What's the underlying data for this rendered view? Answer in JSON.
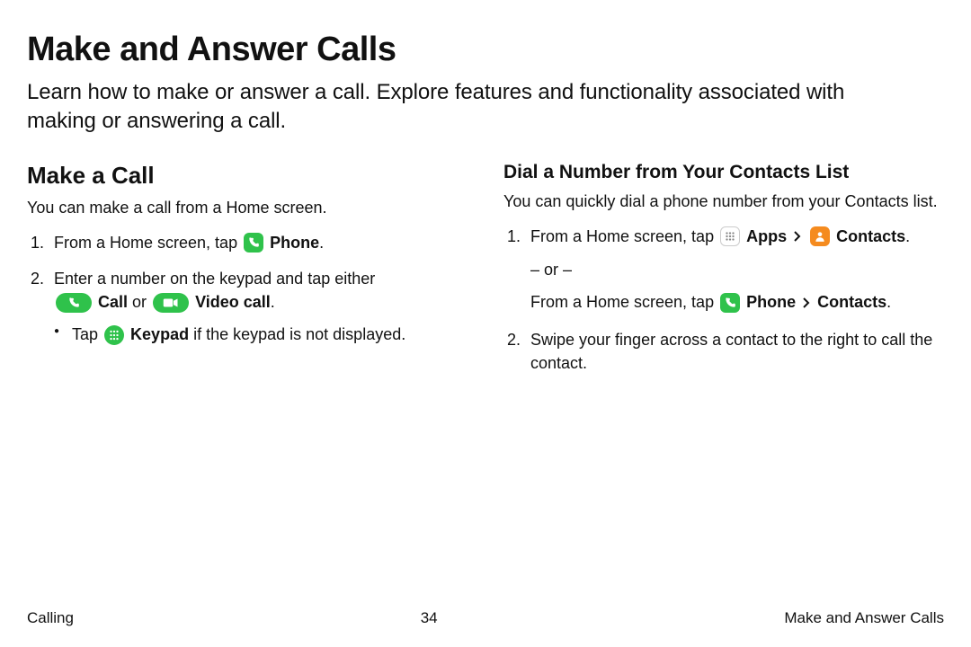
{
  "page": {
    "title": "Make and Answer Calls",
    "intro": "Learn how to make or answer a call. Explore features and functionality associated with making or answering a call."
  },
  "left": {
    "heading": "Make a Call",
    "intro": "You can make a call from a Home screen.",
    "step1": {
      "num": "1.",
      "pre": "From a Home screen, tap ",
      "phone_label": "Phone",
      "post": "."
    },
    "step2": {
      "num": "2.",
      "line": "Enter a number on the keypad and tap either",
      "call_label": "Call",
      "or": " or ",
      "video_label": "Video call",
      "period": ".",
      "bullet_pre": "Tap ",
      "bullet_bold": "Keypad",
      "bullet_post": " if the keypad is not displayed."
    }
  },
  "right": {
    "heading": "Dial a Number from Your Contacts List",
    "intro": "You can quickly dial a phone number from your Contacts list.",
    "step1": {
      "num": "1.",
      "pre": "From a Home screen, tap ",
      "apps_label": "Apps",
      "contacts_label": "Contacts",
      "period": ".",
      "or": "– or –",
      "alt_pre": "From a Home screen, tap ",
      "phone_label": "Phone",
      "alt_contacts": "Contacts",
      "alt_period": "."
    },
    "step2": {
      "num": "2.",
      "text": "Swipe your finger across a contact to the right to call the contact."
    }
  },
  "footer": {
    "left": "Calling",
    "center": "34",
    "right": "Make and Answer Calls"
  }
}
